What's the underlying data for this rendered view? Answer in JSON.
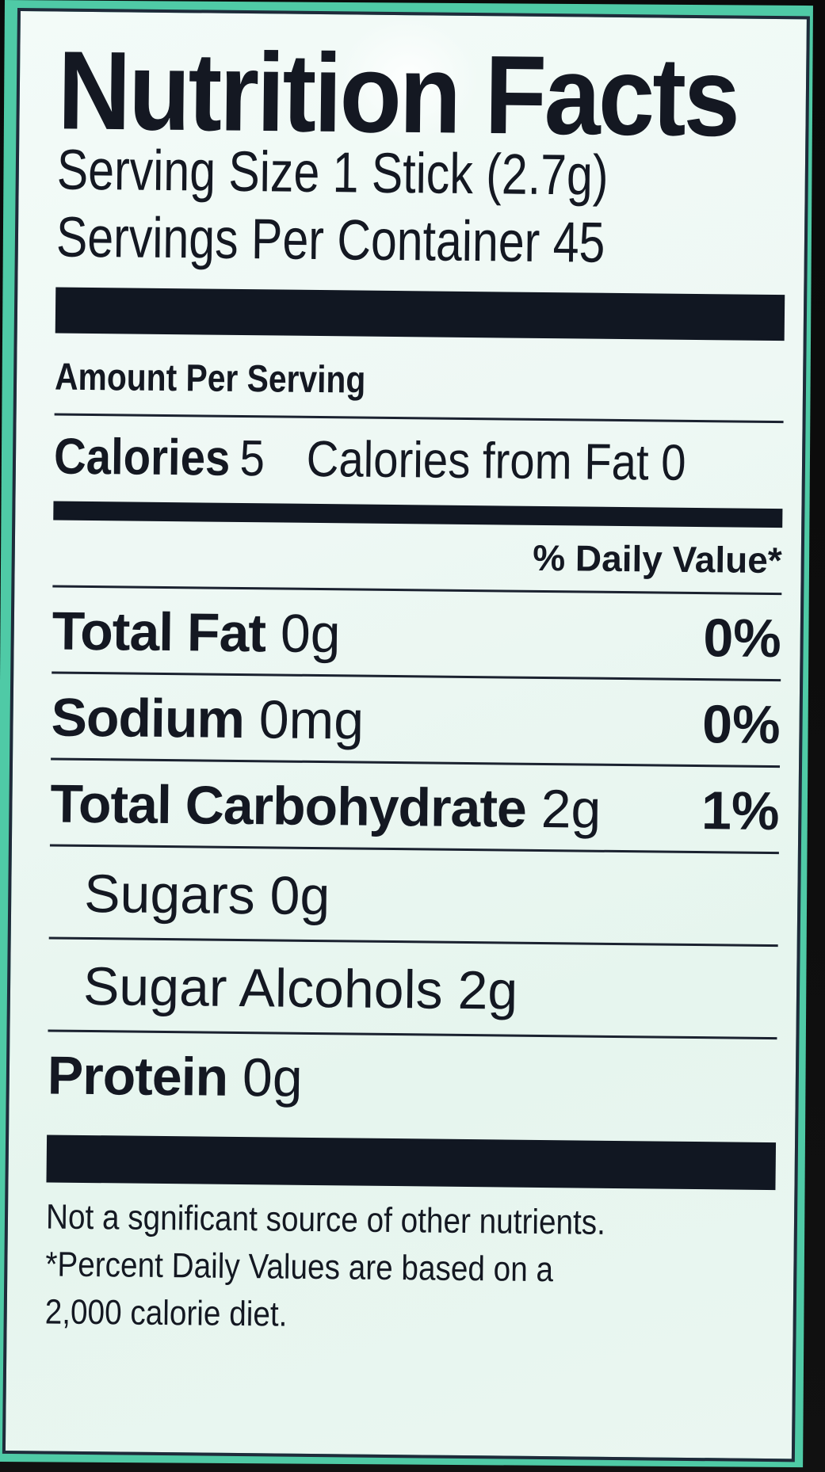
{
  "label": {
    "title": "Nutrition Facts",
    "serving_size": "Serving Size 1 Stick (2.7g)",
    "servings_per_container": "Servings Per Container 45",
    "amount_per_serving": "Amount Per Serving",
    "calories_label": "Calories",
    "calories_value": "5",
    "calories_from_fat": "Calories from Fat 0",
    "daily_value_header": "% Daily Value*",
    "nutrients": [
      {
        "name": "Total Fat",
        "amount": "0g",
        "dv": "0%"
      },
      {
        "name": "Sodium",
        "amount": "0mg",
        "dv": "0%"
      },
      {
        "name": "Total Carbohydrate",
        "amount": "2g",
        "dv": "1%"
      },
      {
        "name": "Sugars",
        "amount": "0g",
        "dv": ""
      },
      {
        "name": "Sugar Alcohols",
        "amount": "2g",
        "dv": ""
      },
      {
        "name": "Protein",
        "amount": "0g",
        "dv": ""
      }
    ],
    "footnote_lines": [
      "Not a sgnificant source of other nutrients.",
      "*Percent Daily Values are based on a",
      "2,000 calorie diet."
    ]
  },
  "colors": {
    "ink": "#141822",
    "panel": "#eef8f4",
    "package_teal": "#4fcaa6"
  }
}
